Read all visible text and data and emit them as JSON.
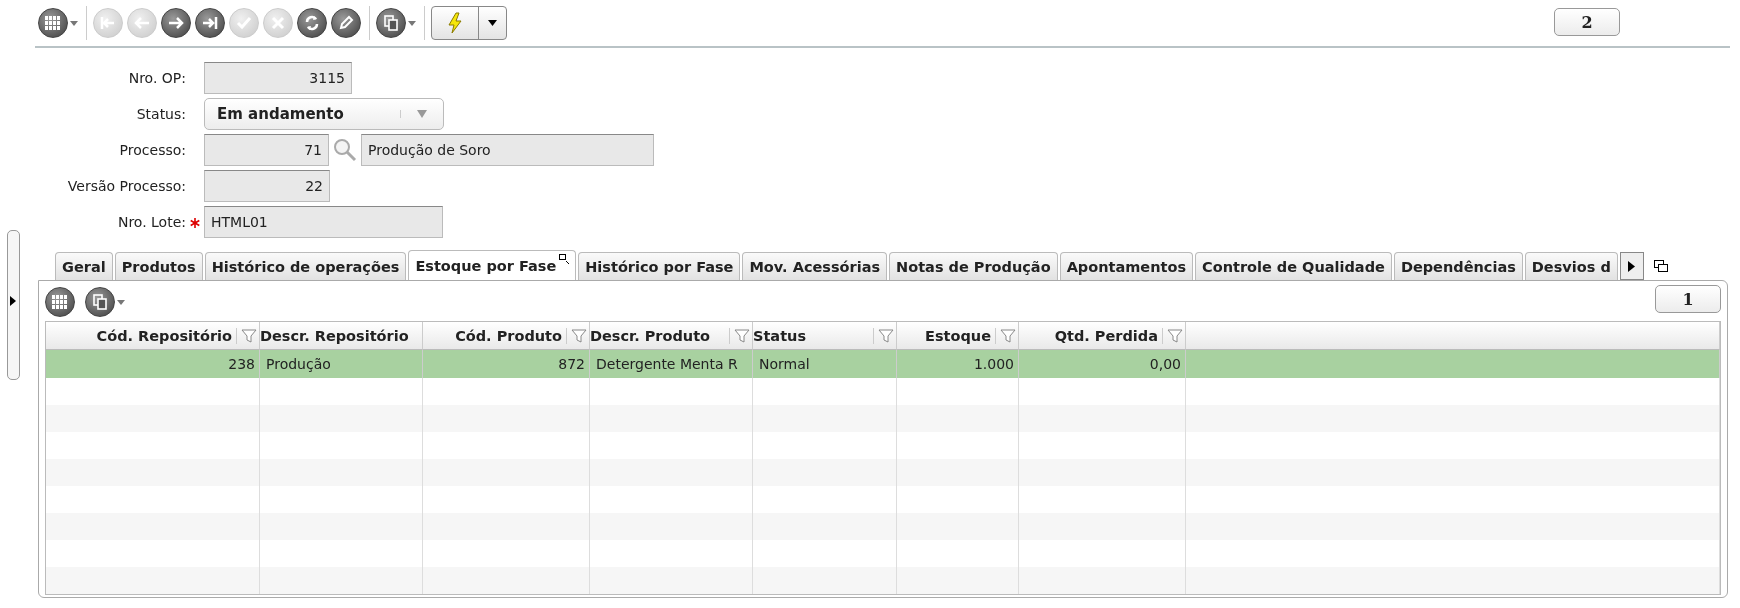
{
  "toolbar": [
    {
      "kind": "grid",
      "disabled": false
    },
    {
      "kind": "first",
      "disabled": true
    },
    {
      "kind": "prev",
      "disabled": true
    },
    {
      "kind": "next",
      "disabled": false
    },
    {
      "kind": "last",
      "disabled": false
    },
    {
      "kind": "confirm",
      "disabled": true
    },
    {
      "kind": "cancel",
      "disabled": true
    },
    {
      "kind": "refresh",
      "disabled": false
    },
    {
      "kind": "edit",
      "disabled": false
    },
    {
      "kind": "copy",
      "disabled": false
    }
  ],
  "page_badge": "2",
  "form": [
    {
      "kind": "number",
      "label": "Nro. OP:",
      "value": "3115"
    },
    {
      "kind": "select",
      "label": "Status:",
      "value": "Em andamento"
    },
    {
      "kind": "lookup",
      "label": "Processo:",
      "value": "71",
      "description": "Produção de Soro"
    },
    {
      "kind": "short",
      "label": "Versão Processo:",
      "value": "22"
    },
    {
      "kind": "required",
      "label": "Nro. Lote:",
      "value": "HTML01"
    }
  ],
  "tabs": [
    {
      "label": "Geral",
      "selected": false
    },
    {
      "label": "Produtos",
      "selected": false
    },
    {
      "label": "Histórico de operações",
      "selected": false
    },
    {
      "label": "Estoque por Fase",
      "selected": true
    },
    {
      "label": "Histórico por Fase",
      "selected": false
    },
    {
      "label": "Mov. Acessórias",
      "selected": false
    },
    {
      "label": "Notas de Produção",
      "selected": false
    },
    {
      "label": "Apontamentos",
      "selected": false
    },
    {
      "label": "Controle de Qualidade",
      "selected": false
    },
    {
      "label": "Dependências",
      "selected": false
    },
    {
      "label": "Desvios d",
      "selected": false
    }
  ],
  "grid_badge": "1",
  "table": {
    "columns": [
      {
        "label": "Cód. Repositório",
        "filter": true
      },
      {
        "label": "Descr. Repositório",
        "filter": false
      },
      {
        "label": "Cód. Produto",
        "filter": true
      },
      {
        "label": "Descr. Produto",
        "filter": true
      },
      {
        "label": "Status",
        "filter": true
      },
      {
        "label": "Estoque",
        "filter": true
      },
      {
        "label": "Qtd. Perdida",
        "filter": true
      }
    ],
    "rows": [
      {
        "selected": true,
        "cells": [
          "238",
          "Produção",
          "872",
          "Detergente Menta R",
          "Normal",
          "1.000",
          "0,00"
        ]
      }
    ]
  }
}
